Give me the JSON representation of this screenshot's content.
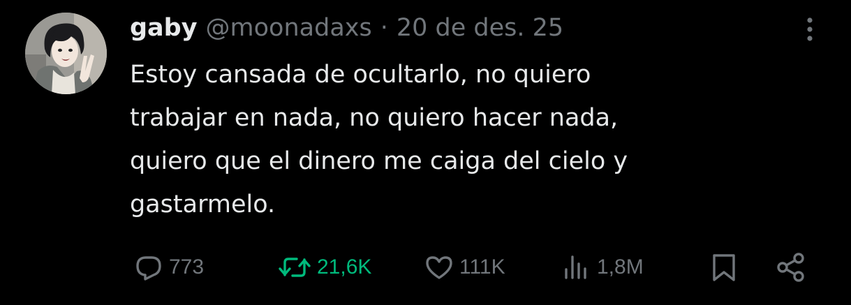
{
  "author": {
    "name": "gaby",
    "handle": "@moonadaxs",
    "separator": "·",
    "date": "20 de des. 25",
    "avatar": "avatar-anime-boy"
  },
  "tweet": {
    "lines": [
      "Estoy cansada de ocultarlo, no quiero",
      "trabajar en nada, no quiero hacer nada,",
      "quiero que el dinero me caiga del cielo y",
      "gastarmelo."
    ]
  },
  "actions": {
    "reply": {
      "icon": "reply-icon",
      "count": "773"
    },
    "retweet": {
      "icon": "retweet-icon",
      "count": "21,6K",
      "active": true
    },
    "like": {
      "icon": "heart-icon",
      "count": "111K"
    },
    "views": {
      "icon": "views-icon",
      "count": "1,8M"
    },
    "bookmark": {
      "icon": "bookmark-icon"
    },
    "share": {
      "icon": "share-icon"
    },
    "more": {
      "icon": "more-vertical-icon"
    }
  },
  "colors": {
    "background": "#000000",
    "text_primary": "#e7e9ea",
    "text_secondary": "#71767b",
    "retweet_active": "#00ba7c"
  }
}
